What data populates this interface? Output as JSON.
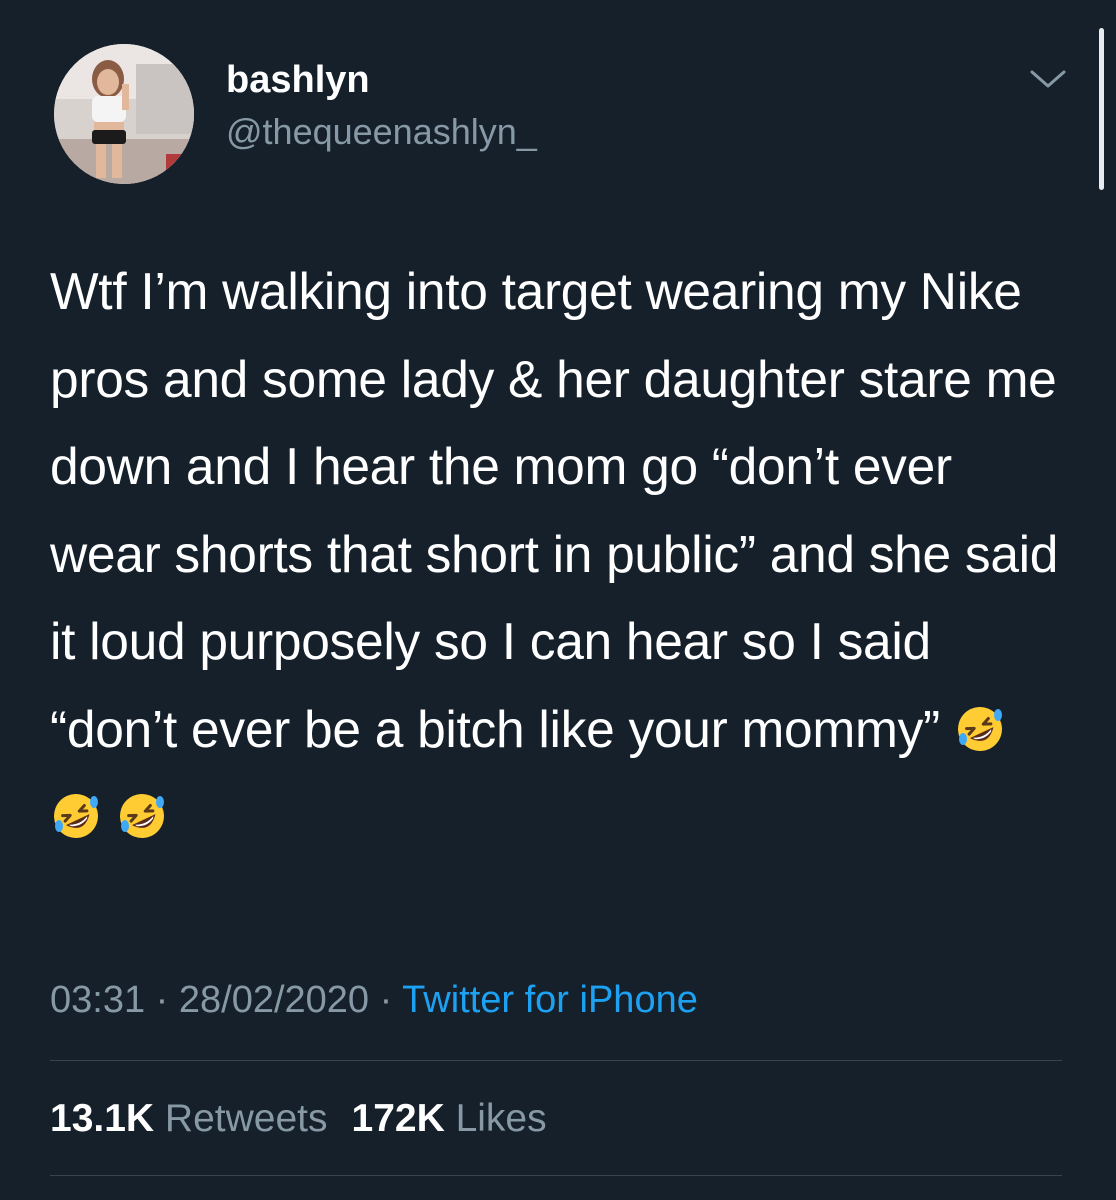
{
  "user": {
    "display_name": "bashlyn",
    "handle": "@thequeenashlyn_"
  },
  "tweet": {
    "text": "Wtf I’m walking into target wearing my Nike pros and some lady & her daughter stare me down and I hear the mom go “don’t ever wear shorts that short in public” and she said it loud purposely so I can hear so I said “don’t ever be a bitch like your mommy”",
    "emoji": [
      "rolling-on-floor-laughing",
      "rolling-on-floor-laughing",
      "rolling-on-floor-laughing"
    ],
    "time": "03:31",
    "separator": "·",
    "date": "28/02/2020",
    "source": "Twitter for iPhone"
  },
  "stats": {
    "retweets_count": "13.1K",
    "retweets_label": "Retweets",
    "likes_count": "172K",
    "likes_label": "Likes"
  },
  "colors": {
    "background": "#15202b",
    "text_primary": "#ffffff",
    "text_secondary": "#8899a6",
    "link": "#1da1f2",
    "divider": "#38444d"
  },
  "icons": {
    "caret": "chevron-down-icon",
    "emoji": "rolling-on-floor-laughing-emoji"
  }
}
